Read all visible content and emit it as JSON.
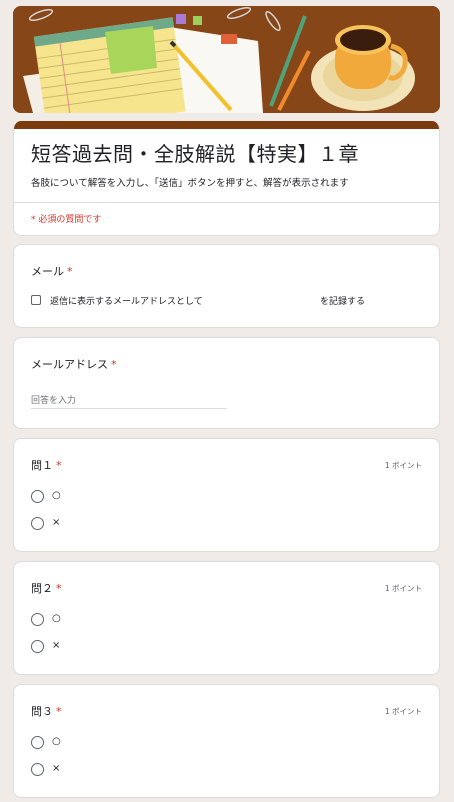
{
  "form": {
    "title": "短答過去問・全肢解説【特実】１章",
    "description": "各肢について解答を入力し、「送信」ボタンを押すと、解答が表示されます",
    "required_note": "* 必須の質問です"
  },
  "email_collect": {
    "label": "メール",
    "required_mark": "*",
    "checkbox_label_left": "返信に表示するメールアドレスとして",
    "checkbox_label_right": "を記録する"
  },
  "email_address": {
    "label": "メールアドレス",
    "required_mark": "*",
    "placeholder": "回答を入力"
  },
  "questions": [
    {
      "label": "問１",
      "required_mark": "*",
      "points": "1 ポイント",
      "options": [
        "○",
        "×"
      ]
    },
    {
      "label": "問２",
      "required_mark": "*",
      "points": "1 ポイント",
      "options": [
        "○",
        "×"
      ]
    },
    {
      "label": "問３",
      "required_mark": "*",
      "points": "1 ポイント",
      "options": [
        "○",
        "×"
      ]
    }
  ],
  "colors": {
    "accent": "#7a3b0d",
    "required": "#d93025",
    "background": "#f0ebe6"
  }
}
